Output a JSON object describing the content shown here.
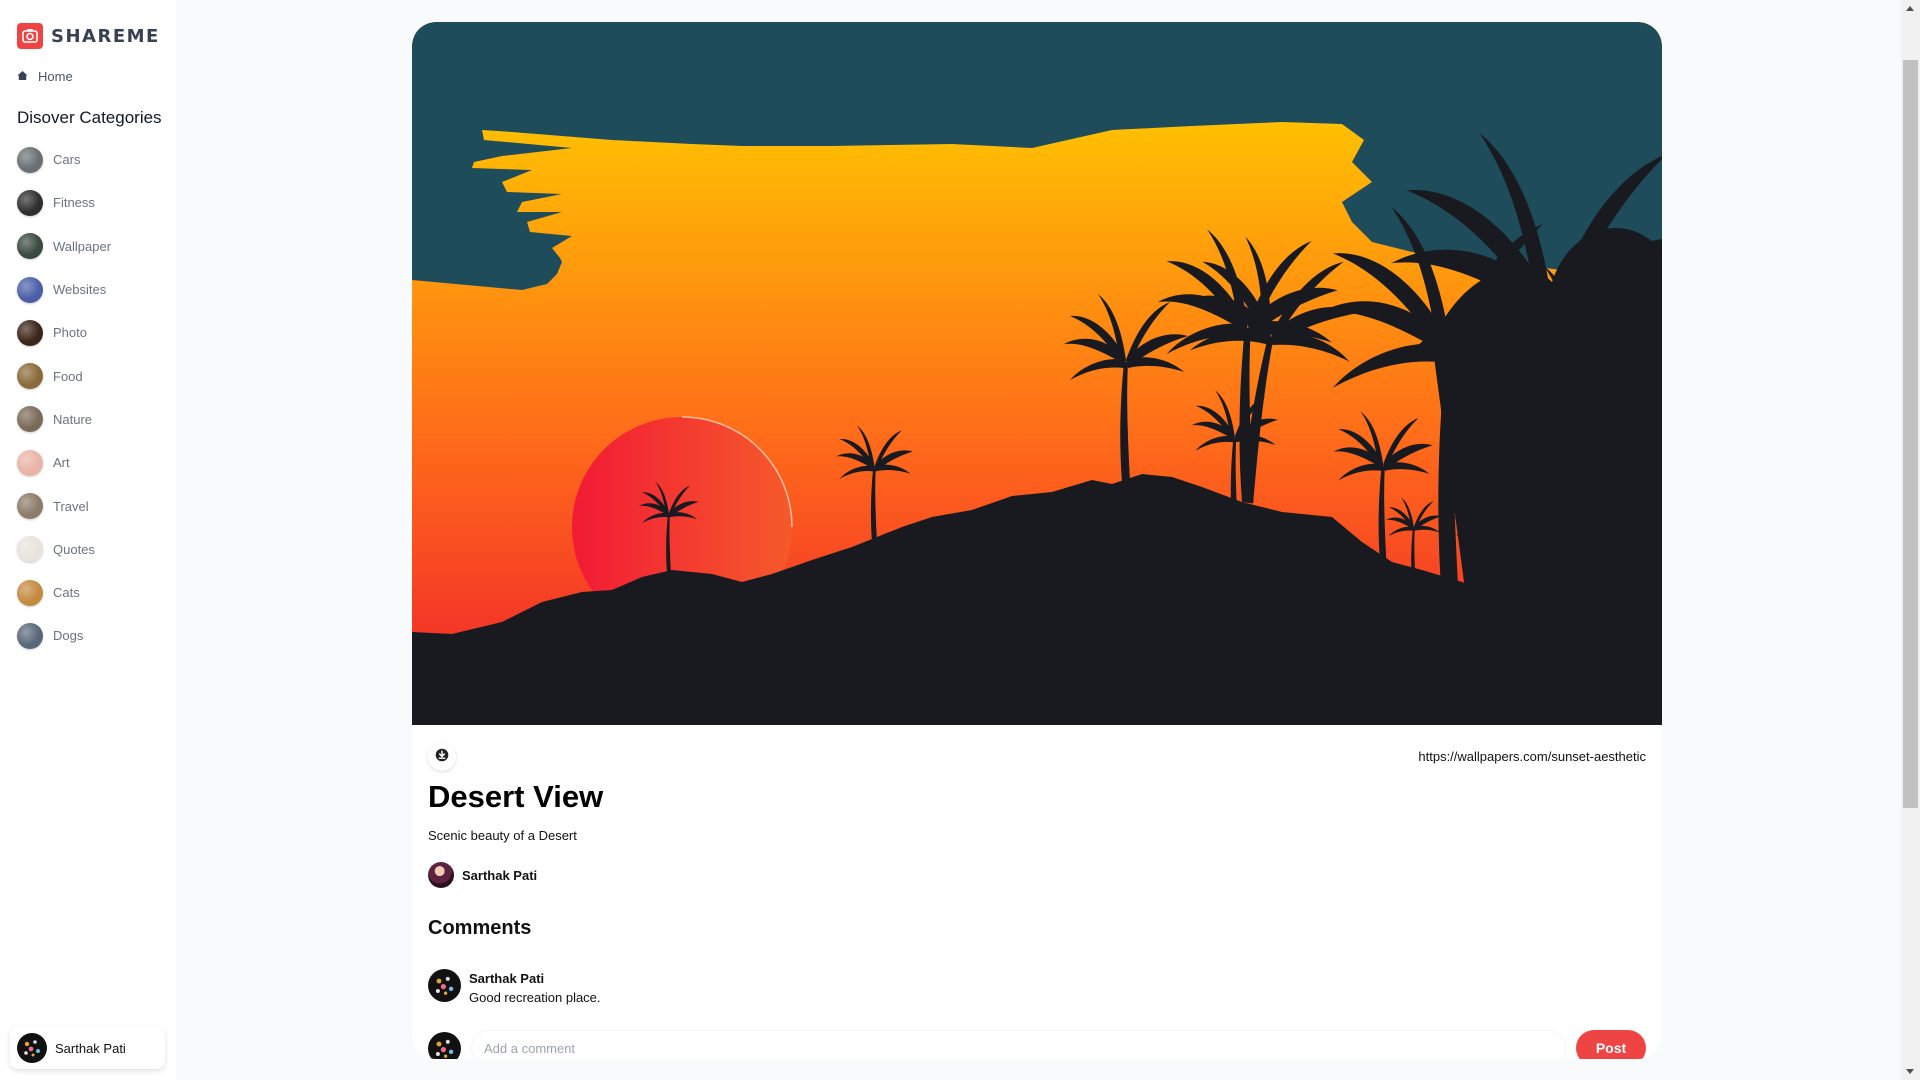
{
  "app": {
    "name": "SHAREME"
  },
  "sidebar": {
    "home_label": "Home",
    "categories_heading": "Disover Categories",
    "categories": [
      {
        "label": "Cars",
        "thumb": "#6b6f75"
      },
      {
        "label": "Fitness",
        "thumb": "#2f2f2f"
      },
      {
        "label": "Wallpaper",
        "thumb": "#3a4a3f"
      },
      {
        "label": "Websites",
        "thumb": "#4a5fa8"
      },
      {
        "label": "Photo",
        "thumb": "#3b2418"
      },
      {
        "label": "Food",
        "thumb": "#8a6a3a"
      },
      {
        "label": "Nature",
        "thumb": "#7a6a58"
      },
      {
        "label": "Art",
        "thumb": "#e9b4a5"
      },
      {
        "label": "Travel",
        "thumb": "#8b7b68"
      },
      {
        "label": "Quotes",
        "thumb": "#e7e4dd"
      },
      {
        "label": "Cats",
        "thumb": "#c48a3e"
      },
      {
        "label": "Dogs",
        "thumb": "#5a6778"
      }
    ],
    "user_name": "Sarthak Pati"
  },
  "pin": {
    "image_alt": "sunset palm tree wallpaper",
    "source_url": "https://wallpapers.com/sunset-aesthetic",
    "title": "Desert View",
    "description": "Scenic beauty of a Desert",
    "author": "Sarthak Pati",
    "comments_heading": "Comments",
    "comments": [
      {
        "author": "Sarthak Pati",
        "text": "Good recreation place."
      }
    ],
    "comment_placeholder": "Add a comment",
    "comment_value": "",
    "post_label": "Post"
  },
  "colors": {
    "accent": "#ef4444",
    "sky_top": "#1e4c5a",
    "sun": "#f0303a",
    "silhouette": "#181a1f"
  }
}
